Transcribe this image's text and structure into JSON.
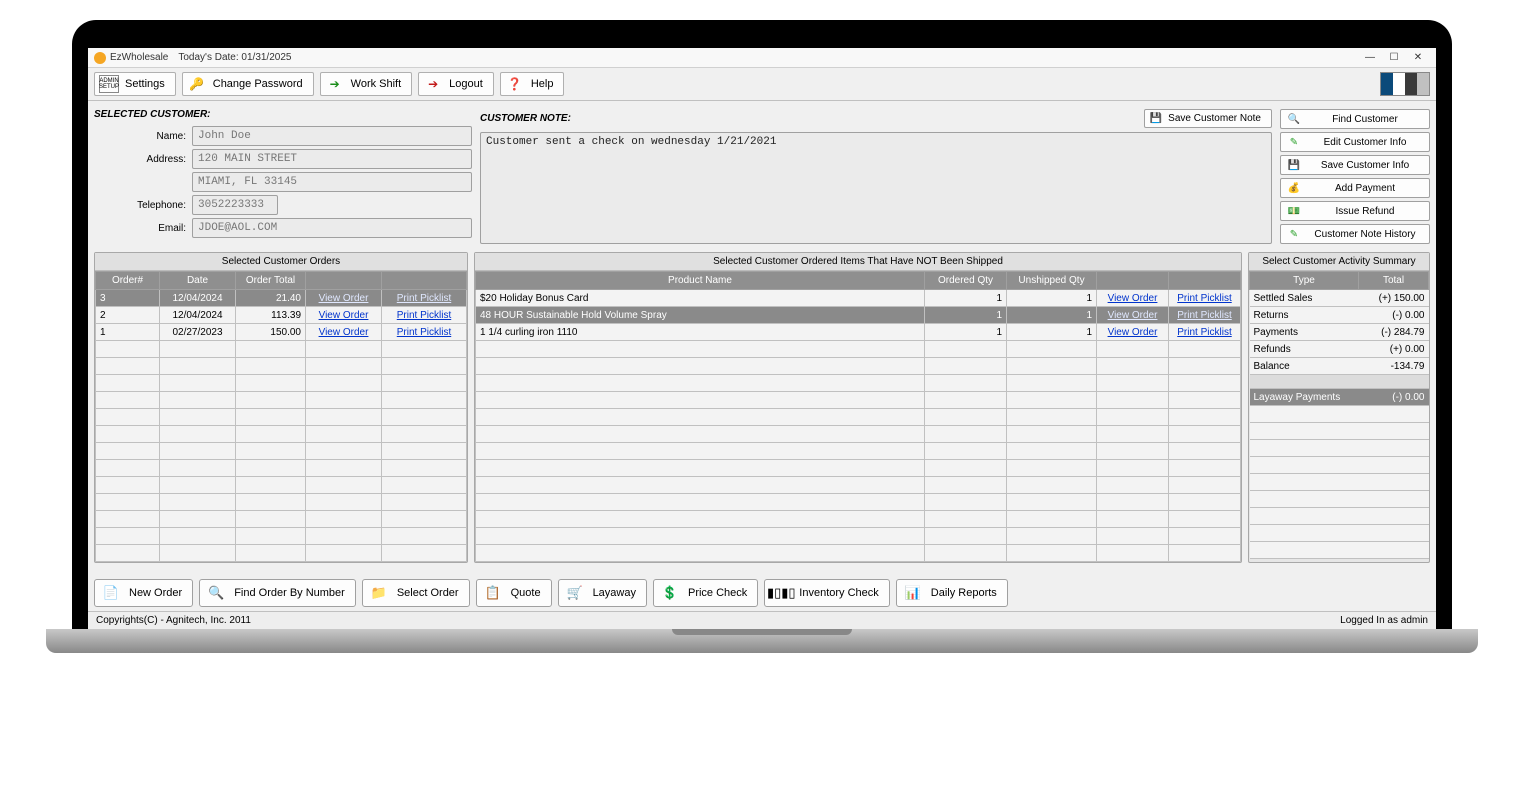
{
  "window": {
    "app_title": "EzWholesale",
    "date_label": "Today's Date: 01/31/2025"
  },
  "toolbar": {
    "settings": "Settings",
    "change_password": "Change Password",
    "work_shift": "Work Shift",
    "logout": "Logout",
    "help": "Help"
  },
  "customer": {
    "section_label": "SELECTED CUSTOMER:",
    "name_label": "Name:",
    "name": "John Doe",
    "address_label": "Address:",
    "address1": "120 MAIN STREET",
    "address2": "MIAMI, FL 33145",
    "telephone_label": "Telephone:",
    "telephone": "3052223333",
    "email_label": "Email:",
    "email": "JDOE@AOL.COM"
  },
  "note": {
    "section_label": "CUSTOMER NOTE:",
    "save_label": "Save Customer Note",
    "text": "Customer sent a check on wednesday 1/21/2021"
  },
  "actions": {
    "find_customer": "Find Customer",
    "edit_customer": "Edit Customer Info",
    "save_customer": "Save Customer Info",
    "add_payment": "Add Payment",
    "issue_refund": "Issue Refund",
    "note_history": "Customer Note History"
  },
  "orders_panel": {
    "title": "Selected Customer Orders",
    "headers": {
      "order_no": "Order#",
      "date": "Date",
      "total": "Order Total"
    },
    "view_label": "View Order",
    "print_label": "Print Picklist",
    "rows": [
      {
        "no": "3",
        "date": "12/04/2024",
        "total": "21.40",
        "selected": true
      },
      {
        "no": "2",
        "date": "12/04/2024",
        "total": "113.39",
        "selected": false
      },
      {
        "no": "1",
        "date": "02/27/2023",
        "total": "150.00",
        "selected": false
      }
    ]
  },
  "unshipped_panel": {
    "title": "Selected Customer Ordered Items That Have NOT Been Shipped",
    "headers": {
      "product": "Product Name",
      "ordered": "Ordered Qty",
      "unshipped": "Unshipped Qty"
    },
    "view_label": "View Order",
    "print_label": "Print Picklist",
    "rows": [
      {
        "product": "$20 Holiday Bonus Card",
        "ordered": "1",
        "unshipped": "1",
        "selected": false
      },
      {
        "product": "48 HOUR Sustainable Hold Volume Spray",
        "ordered": "1",
        "unshipped": "1",
        "selected": true
      },
      {
        "product": "1 1/4 curling iron 1110",
        "ordered": "1",
        "unshipped": "1",
        "selected": false
      }
    ]
  },
  "summary_panel": {
    "title": "Select Customer Activity Summary",
    "headers": {
      "type": "Type",
      "total": "Total"
    },
    "rows": [
      {
        "type": "Settled Sales",
        "total": "(+) 150.00"
      },
      {
        "type": "Returns",
        "total": "(-) 0.00"
      },
      {
        "type": "Payments",
        "total": "(-) 284.79"
      },
      {
        "type": "Refunds",
        "total": "(+) 0.00"
      },
      {
        "type": "Balance",
        "total": "-134.79"
      }
    ],
    "layaway": {
      "type": "Layaway Payments",
      "total": "(-) 0.00"
    }
  },
  "bottom": {
    "new_order": "New Order",
    "find_order": "Find Order By Number",
    "select_order": "Select Order",
    "quote": "Quote",
    "layaway": "Layaway",
    "price_check": "Price Check",
    "inventory_check": "Inventory Check",
    "daily_reports": "Daily Reports"
  },
  "status": {
    "copyright": "Copyrights(C) - Agnitech, Inc. 2011",
    "login": "Logged In as admin"
  }
}
